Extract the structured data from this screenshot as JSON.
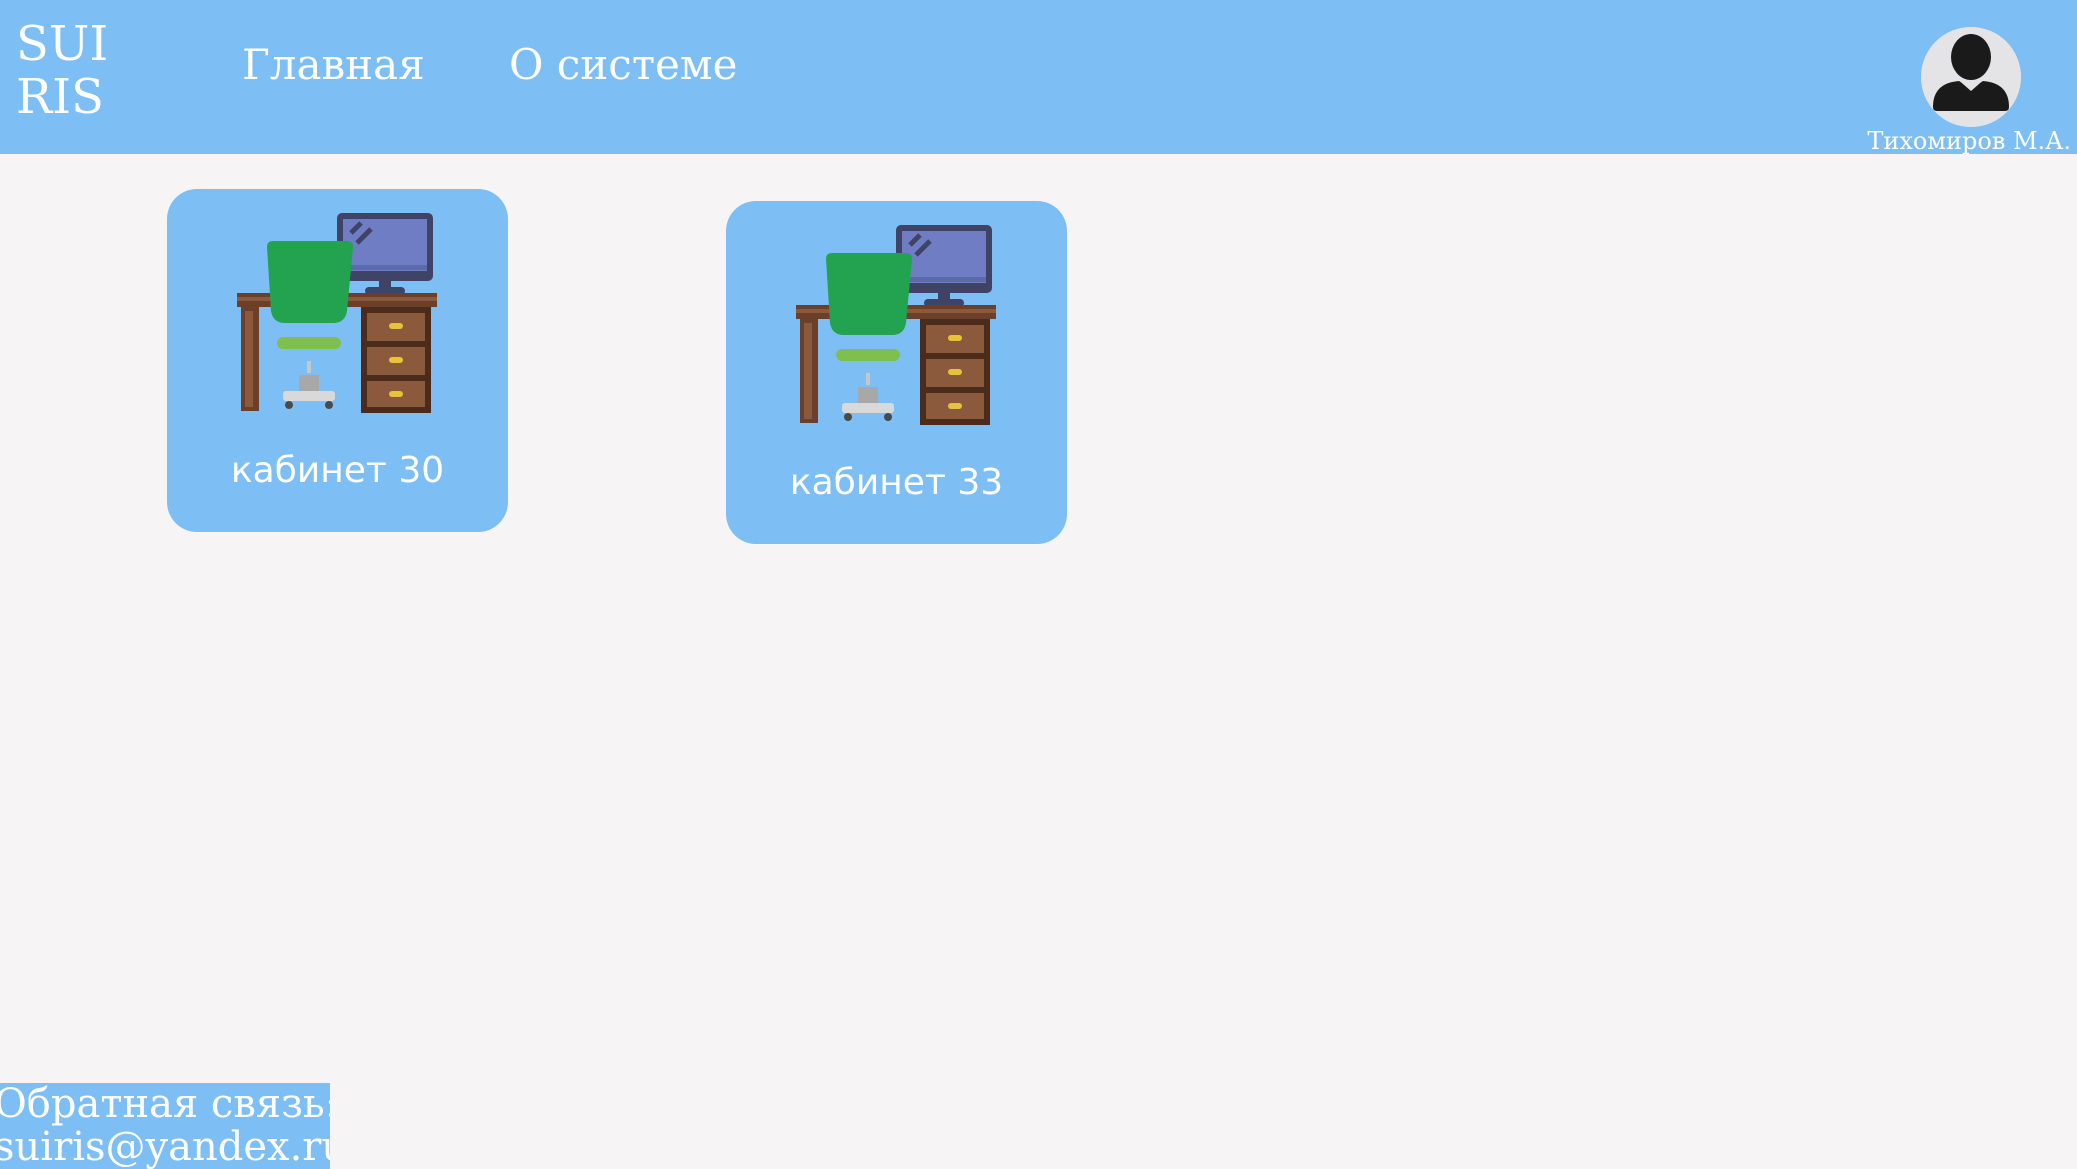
{
  "header": {
    "logo_line1": "SUI",
    "logo_line2": "RIS",
    "nav": {
      "home": "Главная",
      "about": "О системе"
    },
    "user": {
      "name": "Тихомиров М.А.",
      "avatar_icon": "user-avatar-icon"
    }
  },
  "rooms": [
    {
      "label": "кабинет 30",
      "icon": "office-desk-icon"
    },
    {
      "label": "кабинет 33",
      "icon": "office-desk-icon"
    }
  ],
  "footer": {
    "feedback_label": "Обратная связь:",
    "feedback_email": "suiris@yandex.ru"
  },
  "colors": {
    "primary": "#7dbff5",
    "background": "#f6f4f5",
    "text_on_primary": "#ffffff",
    "avatar_bg": "#e4e4e6",
    "monitor": "#6f7ec4",
    "chair": "#23a34f",
    "desk": "#6b3f2a"
  }
}
